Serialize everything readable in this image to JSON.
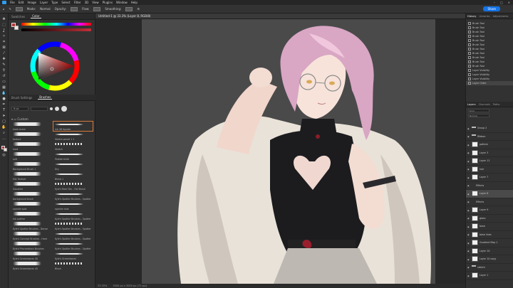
{
  "menubar": {
    "items": [
      "File",
      "Edit",
      "Image",
      "Layer",
      "Type",
      "Select",
      "Filter",
      "3D",
      "View",
      "Plugins",
      "Window",
      "Help"
    ],
    "window_controls": [
      "–",
      "□",
      "✕"
    ]
  },
  "options": {
    "mode_label": "Mode:",
    "mode_value": "Normal",
    "opacity_label": "Opacity:",
    "flow_label": "Flow:",
    "smoothing_label": "Smoothing:",
    "share_label": "Share"
  },
  "colors": {
    "foreground": "#b23a3a",
    "background": "#f0e8e0",
    "accent": "#1473e6",
    "selected_brush_outline": "#d57a3a"
  },
  "left_panel": {
    "tabs": [
      "Swatches",
      "Color"
    ],
    "active_tab": "Color"
  },
  "brushes_panel": {
    "tabs": [
      "Brush Settings",
      "Brushes"
    ],
    "active_tab": "Brushes",
    "size_value": "6 px",
    "folder_name": "Custom",
    "items": [
      {
        "name": "hard round"
      },
      {
        "name": "Ink 4B Xpuder"
      },
      {
        "name": "texture"
      },
      {
        "name": "Sketch pencil 1 1"
      },
      {
        "name": "hard"
      },
      {
        "name": "Sketch"
      },
      {
        "name": "soft"
      },
      {
        "name": "Palette Knife"
      },
      {
        "name": "Background Brush 1"
      },
      {
        "name": "Dry"
      },
      {
        "name": "Mix Texture"
      },
      {
        "name": "Blend 1"
      },
      {
        "name": "Gouache"
      },
      {
        "name": "Kyle's Real Oils - Old Brush"
      },
      {
        "name": "background brush"
      },
      {
        "name": "Kyle's Spatter Brushes - Spatter"
      },
      {
        "name": "sparkle spot"
      },
      {
        "name": "sparkle dust"
      },
      {
        "name": "Ink outline"
      },
      {
        "name": "Kyle's Spatter Brushes - Spatter"
      },
      {
        "name": "Kyle's Spatter Brushes - Dense"
      },
      {
        "name": "Kyle's Spatter Brushes - Spatter"
      },
      {
        "name": "Kyle's Concept Brushes - Hard"
      },
      {
        "name": "Kyle's Spatter Brushes - Spatter"
      },
      {
        "name": "Kyle's Procreations Brushes"
      },
      {
        "name": "Kyle's Spatter Brushes - Spatter"
      },
      {
        "name": "Kyle's Screentones 40"
      },
      {
        "name": "Kyle's Screentones"
      },
      {
        "name": "Kyle's Screentones 45"
      },
      {
        "name": "Blush"
      }
    ]
  },
  "document": {
    "tab_title": "Untitled-1 @ 33.3% (Layer 8, RGB/8)",
    "status_text": "33.33%",
    "status_doc": "3000 px x 3000 px (72 ppi)"
  },
  "history_panel": {
    "tabs": [
      "History",
      "Libraries",
      "Adjustments"
    ],
    "items": [
      "Brush Tool",
      "Brush Tool",
      "Brush Tool",
      "Brush Tool",
      "Brush Tool",
      "Brush Tool",
      "Brush Tool",
      "Brush Tool",
      "Brush Tool",
      "Brush Tool",
      "Brush Tool",
      "Layer Visibility",
      "Layer Visibility",
      "Layer Visibility",
      "Layer Order"
    ]
  },
  "layers_panel": {
    "tabs": [
      "Layers",
      "Channels",
      "Paths"
    ],
    "filter_label": "Kind",
    "blend_mode": "Normal",
    "layers": [
      {
        "name": "Group 2",
        "type": "folder"
      },
      {
        "name": "Ribbon",
        "type": "folder"
      },
      {
        "name": "pattern",
        "type": "layer"
      },
      {
        "name": "Layer 3",
        "type": "layer"
      },
      {
        "name": "Layer 11",
        "type": "layer"
      },
      {
        "name": "hair",
        "type": "layer"
      },
      {
        "name": "Layer 7",
        "type": "layer"
      },
      {
        "name": "Effects",
        "type": "effect"
      },
      {
        "name": "Layer 8",
        "type": "layer"
      },
      {
        "name": "Effects",
        "type": "effect"
      },
      {
        "name": "Layer 9",
        "type": "layer"
      },
      {
        "name": "glass",
        "type": "layer"
      },
      {
        "name": "base",
        "type": "layer"
      },
      {
        "name": "base lines",
        "type": "layer"
      },
      {
        "name": "Gradient Map 1",
        "type": "adjustment"
      },
      {
        "name": "Layer 10",
        "type": "layer"
      },
      {
        "name": "Layer 10 copy",
        "type": "layer"
      },
      {
        "name": "sketch",
        "type": "folder"
      },
      {
        "name": "Layer 1",
        "type": "layer"
      }
    ],
    "selected_index": 8
  }
}
